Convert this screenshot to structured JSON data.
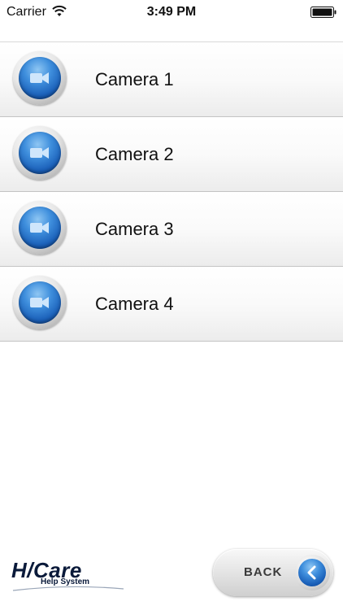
{
  "status_bar": {
    "carrier": "Carrier",
    "time": "3:49 PM",
    "wifi_icon": "wifi-icon",
    "battery_icon": "battery-icon"
  },
  "cameras": [
    {
      "label": "Camera 1",
      "icon": "video-camera-icon"
    },
    {
      "label": "Camera 2",
      "icon": "video-camera-icon"
    },
    {
      "label": "Camera 3",
      "icon": "video-camera-icon"
    },
    {
      "label": "Camera 4",
      "icon": "video-camera-icon"
    }
  ],
  "footer": {
    "logo_main": "H/Care",
    "logo_sub": "Help System",
    "back_label": "BACK",
    "back_icon": "chevron-left-icon"
  },
  "colors": {
    "accent_blue": "#1a5fb8",
    "row_divider": "#c4c4c4",
    "logo_navy": "#0a1a3a"
  }
}
